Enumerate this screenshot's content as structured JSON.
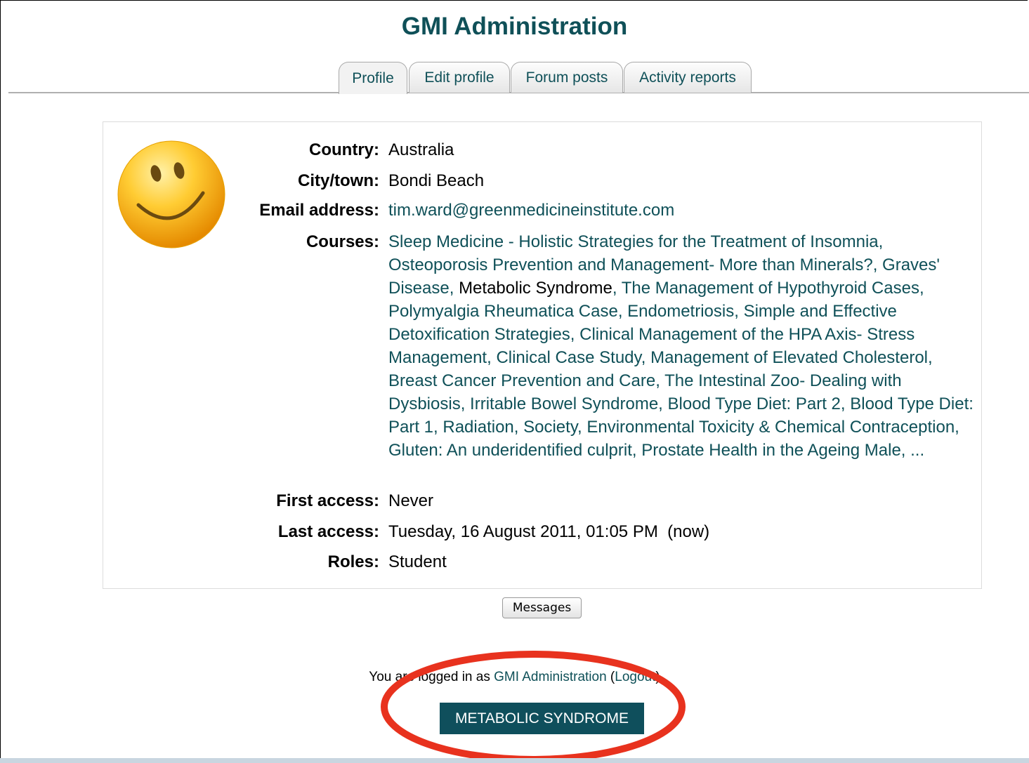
{
  "header": {
    "title": "GMI Administration"
  },
  "tabs": [
    {
      "label": "Profile"
    },
    {
      "label": "Edit profile"
    },
    {
      "label": "Forum posts"
    },
    {
      "label": "Activity reports"
    }
  ],
  "profile": {
    "country_label": "Country:",
    "country": "Australia",
    "city_label": "City/town:",
    "city": "Bondi Beach",
    "email_label": "Email address:",
    "email": "tim.ward@greenmedicineinstitute.com",
    "courses_label": "Courses:",
    "courses": [
      "Sleep Medicine - Holistic Strategies for the Treatment of Insomnia",
      "Osteoporosis Prevention and Management- More than Minerals?",
      "Graves' Disease",
      "Metabolic Syndrome",
      "The Management of Hypothyroid Cases",
      "Polymyalgia Rheumatica Case",
      "Endometriosis",
      "Simple and Effective Detoxification Strategies",
      "Clinical Management of the HPA Axis- Stress Management",
      "Clinical Case Study",
      "Management of Elevated Cholesterol",
      "Breast Cancer Prevention and Care",
      "The Intestinal Zoo- Dealing with Dysbiosis",
      "Irritable Bowel Syndrome",
      "Blood Type Diet: Part 2",
      "Blood Type Diet: Part 1",
      "Radiation, Society, Environmental Toxicity & Chemical Contraception",
      "Gluten: An underidentified culprit",
      "Prostate Health in the Ageing Male"
    ],
    "courses_more": "...",
    "current_course": "Metabolic Syndrome",
    "first_access_label": "First access:",
    "first_access": "Never",
    "last_access_label": "Last access:",
    "last_access": "Tuesday, 16 August 2011, 01:05 PM  (now)",
    "roles_label": "Roles:",
    "roles": "Student"
  },
  "messages_button": "Messages",
  "footer": {
    "logged_in_prefix": "You are logged in as",
    "user": "GMI Administration",
    "logout_open": "(",
    "logout": "Logout",
    "logout_close": ")"
  },
  "course_button": "METABOLIC SYNDROME",
  "icons": {
    "avatar": "smiley-face-icon"
  },
  "colors": {
    "accent": "#0f5058",
    "highlight": "#e8321e",
    "button": "#0f4f5c"
  }
}
